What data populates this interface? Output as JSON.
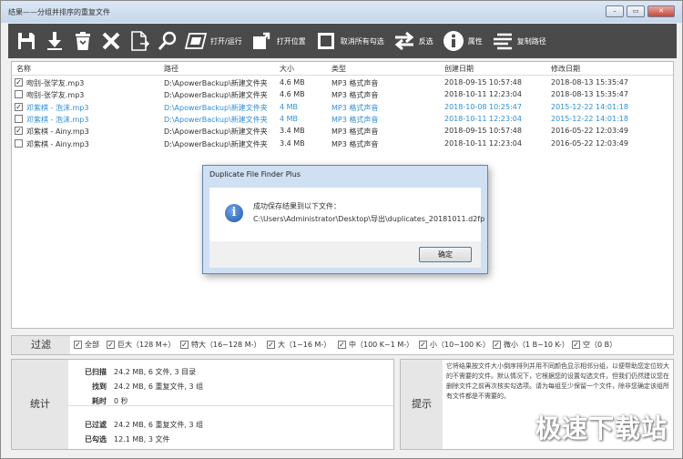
{
  "window": {
    "title": "结果——分组并排序的重复文件"
  },
  "toolbar": {
    "items": [
      {
        "icon": "save-icon",
        "label": ""
      },
      {
        "icon": "download-icon",
        "label": ""
      },
      {
        "icon": "trash-icon",
        "label": ""
      },
      {
        "icon": "delete-x-icon",
        "label": ""
      },
      {
        "icon": "file-export-icon",
        "label": ""
      },
      {
        "icon": "search-icon",
        "label": ""
      },
      {
        "icon": "open-run-icon",
        "label": "打开/运行"
      },
      {
        "icon": "open-location-icon",
        "label": "打开位置"
      },
      {
        "icon": "uncheck-all-icon",
        "label": "取消所有勾选"
      },
      {
        "icon": "invert-selection-icon",
        "label": "反选"
      },
      {
        "icon": "info-icon",
        "label": "属性"
      },
      {
        "icon": "copy-path-icon",
        "label": "复制路径"
      }
    ]
  },
  "list": {
    "columns": [
      "名称",
      "路径",
      "大小",
      "类型",
      "创建日期",
      "修改日期"
    ],
    "rows": [
      {
        "checked": true,
        "name": "吻别-张学友.mp3",
        "path": "D:\\ApowerBackup\\新建文件夹",
        "size": "4.6 MB",
        "type": "MP3 格式声音",
        "created": "2018-09-15 10:57:48",
        "modified": "2018-08-13 15:35:47",
        "blue": false
      },
      {
        "checked": false,
        "name": "吻别-张学友.mp3",
        "path": "D:\\ApowerBackup\\新建文件夹",
        "size": "4.6 MB",
        "type": "MP3 格式声音",
        "created": "2018-10-11 12:23:04",
        "modified": "2018-08-13 15:35:47",
        "blue": false
      },
      {
        "checked": true,
        "name": "邓紫棋 - 泡沫.mp3",
        "path": "D:\\ApowerBackup\\新建文件夹",
        "size": "4 MB",
        "type": "MP3 格式声音",
        "created": "2018-10-08 10:25:47",
        "modified": "2015-12-22 14:01:18",
        "blue": true
      },
      {
        "checked": false,
        "name": "邓紫棋 - 泡沫.mp3",
        "path": "D:\\ApowerBackup\\新建文件夹",
        "size": "4 MB",
        "type": "MP3 格式声音",
        "created": "2018-10-11 12:23:04",
        "modified": "2015-12-22 14:01:18",
        "blue": true
      },
      {
        "checked": true,
        "name": "邓紫棋 - Ainy.mp3",
        "path": "D:\\ApowerBackup\\新建文件夹",
        "size": "3.4 MB",
        "type": "MP3 格式声音",
        "created": "2018-09-15 10:57:48",
        "modified": "2016-05-22 12:03:49",
        "blue": false
      },
      {
        "checked": false,
        "name": "邓紫棋 - Ainy.mp3",
        "path": "D:\\ApowerBackup\\新建文件夹",
        "size": "3.4 MB",
        "type": "MP3 格式声音",
        "created": "2018-10-11 12:23:04",
        "modified": "2016-05-22 12:03:49",
        "blue": false
      }
    ]
  },
  "dialog": {
    "title": "Duplicate File Finder Plus",
    "message": "成功保存结果到以下文件：",
    "path": "C:\\Users\\Administrator\\Desktop\\导出\\duplicates_20181011.d2fp",
    "ok": "确定"
  },
  "filter": {
    "title": "过滤",
    "items": [
      {
        "label": "全部",
        "checked": true
      },
      {
        "label": "巨大（128 M+）",
        "checked": true
      },
      {
        "label": "特大（16~128 M-）",
        "checked": true
      },
      {
        "label": "大（1~16 M-）",
        "checked": true
      },
      {
        "label": "中（100 K~1 M-）",
        "checked": true
      },
      {
        "label": "小（10~100 K-）",
        "checked": true
      },
      {
        "label": "微小（1 B~10 K-）",
        "checked": true
      },
      {
        "label": "空（0 B）",
        "checked": true
      }
    ]
  },
  "stats": {
    "title": "统计",
    "scanned_label": "已扫描",
    "scanned": "24.2 MB, 6 文件, 3 目录",
    "found_label": "找到",
    "found": "24.2 MB, 6 重复文件, 3 组",
    "time_label": "耗时",
    "time": "0 秒",
    "filtered_label": "已过滤",
    "filtered": "24.2 MB, 6 重复文件, 3 组",
    "checked_label": "已勾选",
    "checked": "12.1 MB, 3 文件"
  },
  "tips": {
    "title": "提示",
    "text": "它将结果按文件大小倒序排列并用不同颜色显示相邻分组，以便帮助您定位较大的不需要的文件。默认情况下，它根据您的设置勾选文件，但我们仍然建议您在删除文件之前再次核实勾选项。请为每组至少保留一个文件，除非您确定该组所有文件都是不需要的。"
  },
  "watermark": "极速下载站",
  "colors": {
    "toolbar_bg": "#4a4a4a",
    "alt_group": "#2f8fd6",
    "dialog_frame": "#cfe0f3"
  }
}
